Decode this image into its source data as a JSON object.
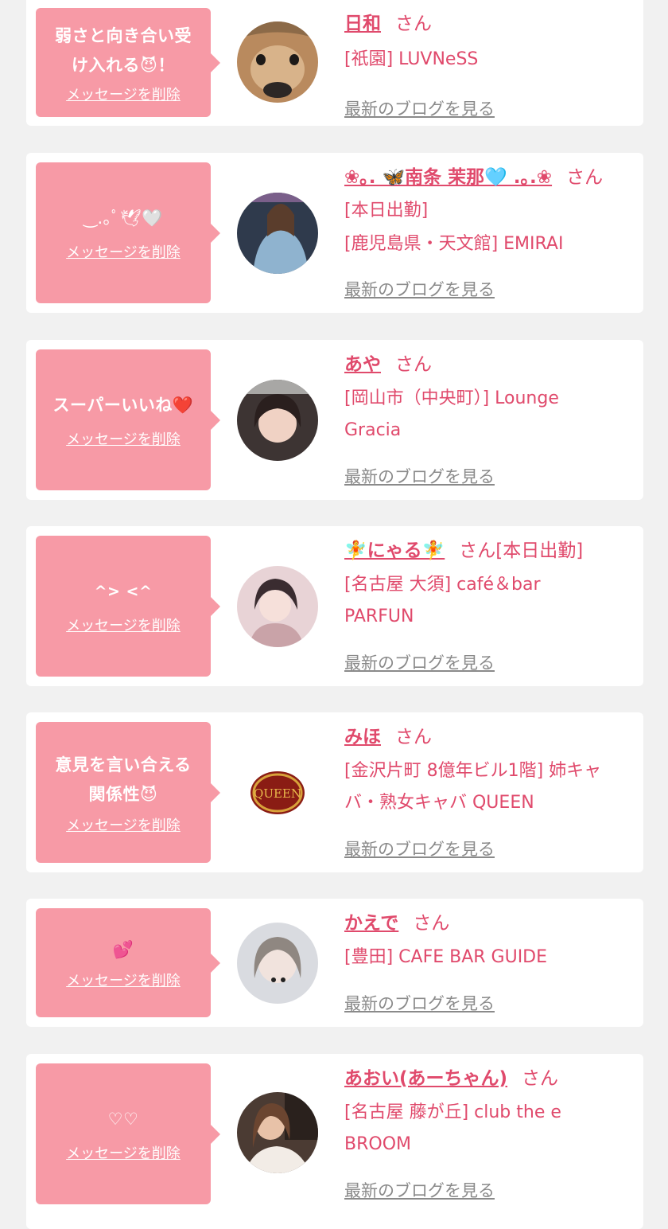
{
  "delete_label": "メッセージを削除",
  "blog_label": "最新のブログを見る",
  "cards": [
    {
      "message": [
        "弱さと向き合い受",
        "け入れる😈！"
      ],
      "name": "日和",
      "san": "さん",
      "shop": [
        "[祇園] LUVNeSS"
      ],
      "avatar_icon": "dog-photo"
    },
    {
      "message": [
        "‿.｡ﾟ🕊🤍"
      ],
      "name": "❀｡. 🦋南条 茉那🩵 .｡.❀",
      "san": "さん",
      "shop": [
        "[本日出勤]",
        "[鹿児島県・天文館] EMIRAI"
      ],
      "avatar_icon": "woman-photo"
    },
    {
      "message": [
        "スーパーいいね❤️"
      ],
      "name": "あや",
      "san": "さん",
      "shop": [
        "[岡山市（中央町）] Lounge",
        "Gracia"
      ],
      "avatar_icon": "woman-photo"
    },
    {
      "message": [
        "^> <^"
      ],
      "name": "🧚にゃる🧚",
      "san": "さん[本日出勤]",
      "shop": [
        "[名古屋 大須] café＆bar",
        "PARFUN"
      ],
      "avatar_icon": "woman-photo"
    },
    {
      "message": [
        "意見を言い合える",
        "関係性😈"
      ],
      "name": "みほ",
      "san": "さん",
      "shop": [
        "[金沢片町 8億年ビル1階] 姉キャ",
        "バ・熟女キャバ QUEEN"
      ],
      "avatar_icon": "queen-logo",
      "logo_text": "QUEEN"
    },
    {
      "message": [
        "💕"
      ],
      "name": "かえで",
      "san": "さん",
      "shop": [
        "[豊田] CAFE BAR GUIDE"
      ],
      "avatar_icon": "woman-photo"
    },
    {
      "message": [
        "♡♡"
      ],
      "name": "あおい(あーちゃん)",
      "san": "さん",
      "shop": [
        "[名古屋 藤が丘] club the e",
        "BROOM"
      ],
      "avatar_icon": "woman-photo"
    }
  ]
}
